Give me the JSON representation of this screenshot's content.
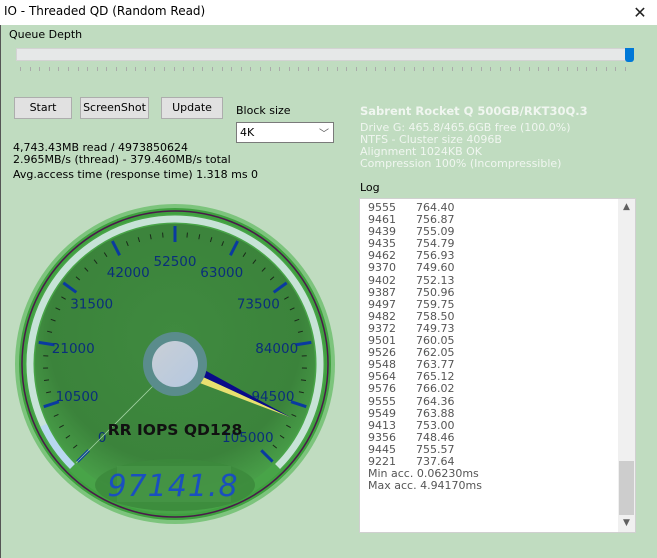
{
  "window": {
    "title": "IO - Threaded QD (Random Read)",
    "close_icon": "close-icon"
  },
  "queue_depth": {
    "label": "Queue Depth",
    "slider_value_fraction": 1.0
  },
  "buttons": {
    "start": "Start",
    "screenshot": "ScreenShot",
    "update": "Update"
  },
  "block_size": {
    "label": "Block size",
    "selected": "4K"
  },
  "stats": {
    "read": "4,743.43MB read / 4973850624",
    "speed": "2.965MB/s (thread) - 379.460MB/s total",
    "access_time": "Avg.access time (response time) 1.318 ms",
    "counter": "0"
  },
  "drive": {
    "name": "Sabrent Rocket Q 500GB/RKT30Q.3",
    "free": "Drive G: 465.8/465.6GB free (100.0%)",
    "fs": "NTFS - Cluster size 4096B",
    "alignment": "Alignment 1024KB OK",
    "compression": "Compression 100% (Incompressible)"
  },
  "log": {
    "label": "Log",
    "rows": [
      [
        "9555",
        "764.40"
      ],
      [
        "9461",
        "756.87"
      ],
      [
        "9439",
        "755.09"
      ],
      [
        "9435",
        "754.79"
      ],
      [
        "9462",
        "756.93"
      ],
      [
        "9370",
        "749.60"
      ],
      [
        "9402",
        "752.13"
      ],
      [
        "9387",
        "750.96"
      ],
      [
        "9497",
        "759.75"
      ],
      [
        "9482",
        "758.50"
      ],
      [
        "9372",
        "749.73"
      ],
      [
        "9501",
        "760.05"
      ],
      [
        "9526",
        "762.05"
      ],
      [
        "9548",
        "763.77"
      ],
      [
        "9564",
        "765.12"
      ],
      [
        "9576",
        "766.02"
      ],
      [
        "9555",
        "764.36"
      ],
      [
        "9549",
        "763.88"
      ],
      [
        "9413",
        "753.00"
      ],
      [
        "9356",
        "748.46"
      ],
      [
        "9445",
        "755.57"
      ],
      [
        "9221",
        "737.64"
      ]
    ],
    "min_acc": "Min acc. 0.06230ms",
    "max_acc": "Max acc. 4.94170ms",
    "scroll_up_icon": "chevron-up-icon",
    "scroll_down_icon": "chevron-down-icon"
  },
  "gauge": {
    "title": "RR IOPS QD128",
    "min": 0,
    "max": 105000,
    "value": 97141.8,
    "display": "97141.8",
    "tick_labels": [
      "0",
      "10500",
      "21000",
      "31500",
      "42000",
      "52500",
      "63000",
      "73500",
      "84000",
      "94500",
      "105000"
    ],
    "colors": {
      "face": "#3f8f3f",
      "label": "#0a2f7a",
      "needle": "#0a0a8a",
      "needle_shadow": "#e8e070",
      "lcd": "#1a4fbf"
    }
  }
}
